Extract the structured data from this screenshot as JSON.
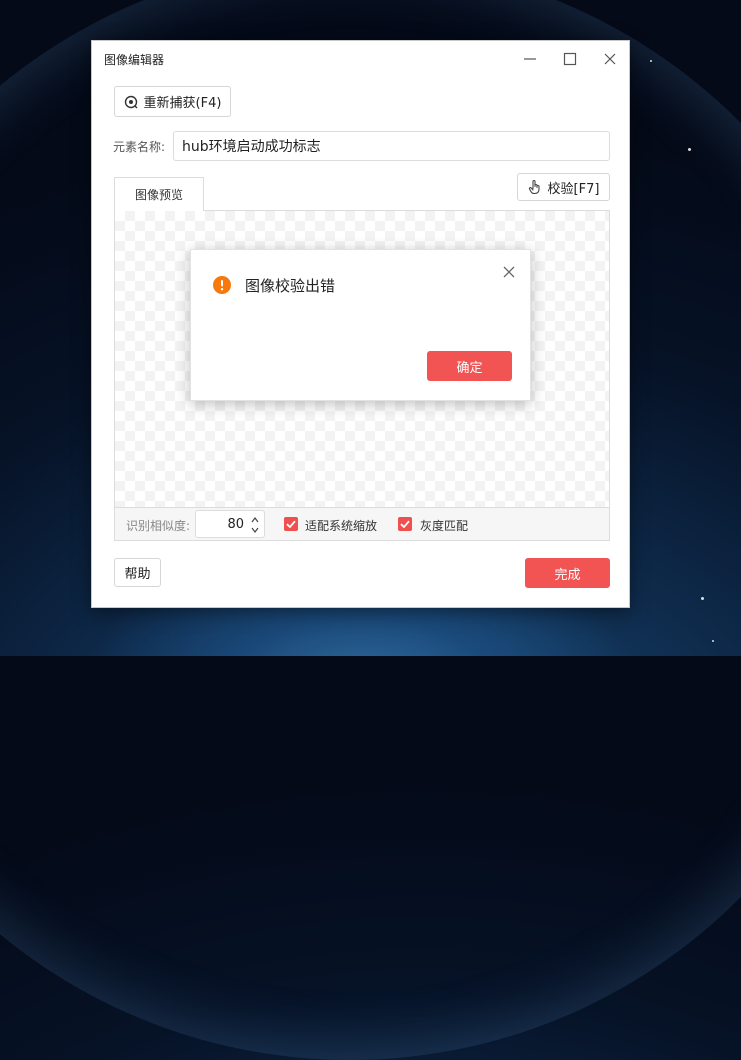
{
  "window": {
    "title": "图像编辑器",
    "recapture_label": "重新捕获(F4)",
    "element_name_label": "元素名称:",
    "element_name_value": "hub环境启动成功标志",
    "tab_preview": "图像预览",
    "verify_label": "校验[F7]",
    "similarity_label": "识别相似度:",
    "similarity_value": "80",
    "fit_scale_label": "适配系统缩放",
    "fit_scale_checked": true,
    "grayscale_label": "灰度匹配",
    "grayscale_checked": true,
    "help_label": "帮助",
    "done_label": "完成"
  },
  "dialog": {
    "message": "图像校验出错",
    "confirm_label": "确定",
    "icon": "warning-icon"
  },
  "colors": {
    "accent": "#f25454",
    "warning": "#f7780c"
  }
}
